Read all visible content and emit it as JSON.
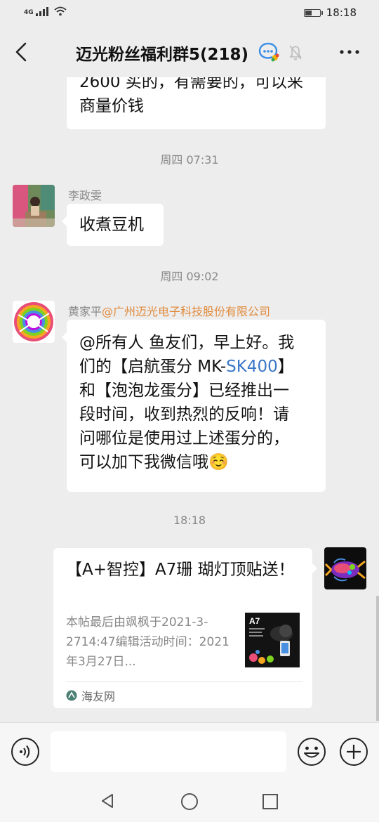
{
  "status_bar": {
    "network": "4G",
    "time": "18:18"
  },
  "header": {
    "title": "迈光粉丝福利群5(218)"
  },
  "messages": {
    "m1": {
      "line1": "2600 买的，有需要的，可以来",
      "line2": "商量价钱"
    },
    "ts1": "周四 07:31",
    "m2": {
      "sender": "李政雯",
      "text": "收煮豆机"
    },
    "ts2": "周四 09:02",
    "m3": {
      "sender": "黄家平",
      "org": "@广州迈光电子科技股份有限公司",
      "l1": "@所有人 鱼友们，早上好。我",
      "l2a": "们的【启航蛋分 MK-",
      "l2b": "SK400",
      "l2c": "】",
      "l3": "和【泡泡龙蛋分】已经推出一",
      "l4": "段时间，收到热烈的反响！请",
      "l5": "问哪位是使用过上述蛋分的，",
      "l6": "可以加下我微信哦☺️"
    },
    "ts3": "18:18",
    "card": {
      "title": "【A+智控】A7珊 瑚灯顶贴送！",
      "desc": "本帖最后由飒枫于2021-3-2714:47编辑活动时间：2021年3月27日...",
      "thumb_label": "A7",
      "source": "海友网"
    }
  },
  "colors": {
    "background": "#ededed",
    "bubble": "#ffffff",
    "org_mention": "#e08a3c",
    "link": "#3a77c7"
  },
  "icons": {
    "back": "chevron-left-icon",
    "group": "group-chat-icon",
    "mute": "bell-off-icon",
    "more": "more-icon",
    "voice": "voice-icon",
    "emoji": "emoji-icon",
    "plus": "plus-icon"
  }
}
